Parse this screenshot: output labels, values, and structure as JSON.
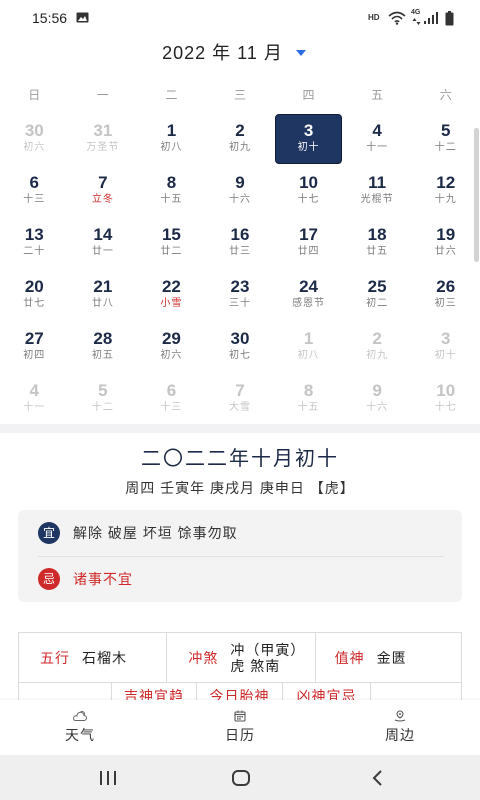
{
  "theme": {
    "navy": "#1f3562",
    "red": "#cf2a2a",
    "dropdown_blue": "#2d6be0",
    "muted": "#c4c4c4"
  },
  "status_bar": {
    "time": "15:56",
    "hd": "HD",
    "network": "4G",
    "left_icons": [
      "image-icon"
    ],
    "right_icons": [
      "wifi-icon",
      "signal-icon",
      "battery-icon"
    ]
  },
  "header": {
    "month_label": "2022 年 11 月",
    "dropdown_icon": "triangle-down-icon"
  },
  "weekdays": [
    "日",
    "一",
    "二",
    "三",
    "四",
    "五",
    "六"
  ],
  "calendar": {
    "weeks": [
      [
        {
          "day": "30",
          "sub": "初六",
          "muted": true
        },
        {
          "day": "31",
          "sub": "万圣节",
          "muted": true
        },
        {
          "day": "1",
          "sub": "初八"
        },
        {
          "day": "2",
          "sub": "初九"
        },
        {
          "day": "3",
          "sub": "初十",
          "selected": true
        },
        {
          "day": "4",
          "sub": "十一"
        },
        {
          "day": "5",
          "sub": "十二"
        }
      ],
      [
        {
          "day": "6",
          "sub": "十三"
        },
        {
          "day": "7",
          "sub": "立冬",
          "solar_term": true
        },
        {
          "day": "8",
          "sub": "十五"
        },
        {
          "day": "9",
          "sub": "十六"
        },
        {
          "day": "10",
          "sub": "十七"
        },
        {
          "day": "11",
          "sub": "光棍节"
        },
        {
          "day": "12",
          "sub": "十九"
        }
      ],
      [
        {
          "day": "13",
          "sub": "二十"
        },
        {
          "day": "14",
          "sub": "廿一"
        },
        {
          "day": "15",
          "sub": "廿二"
        },
        {
          "day": "16",
          "sub": "廿三"
        },
        {
          "day": "17",
          "sub": "廿四"
        },
        {
          "day": "18",
          "sub": "廿五"
        },
        {
          "day": "19",
          "sub": "廿六"
        }
      ],
      [
        {
          "day": "20",
          "sub": "廿七"
        },
        {
          "day": "21",
          "sub": "廿八"
        },
        {
          "day": "22",
          "sub": "小雪",
          "solar_term": true
        },
        {
          "day": "23",
          "sub": "三十"
        },
        {
          "day": "24",
          "sub": "感恩节"
        },
        {
          "day": "25",
          "sub": "初二"
        },
        {
          "day": "26",
          "sub": "初三"
        }
      ],
      [
        {
          "day": "27",
          "sub": "初四"
        },
        {
          "day": "28",
          "sub": "初五"
        },
        {
          "day": "29",
          "sub": "初六"
        },
        {
          "day": "30",
          "sub": "初七"
        },
        {
          "day": "1",
          "sub": "初八",
          "muted": true
        },
        {
          "day": "2",
          "sub": "初九",
          "muted": true
        },
        {
          "day": "3",
          "sub": "初十",
          "muted": true
        }
      ],
      [
        {
          "day": "4",
          "sub": "十一",
          "muted": true
        },
        {
          "day": "5",
          "sub": "十二",
          "muted": true
        },
        {
          "day": "6",
          "sub": "十三",
          "muted": true
        },
        {
          "day": "7",
          "sub": "大雪",
          "muted": true
        },
        {
          "day": "8",
          "sub": "十五",
          "muted": true
        },
        {
          "day": "9",
          "sub": "十六",
          "muted": true
        },
        {
          "day": "10",
          "sub": "十七",
          "muted": true
        }
      ]
    ]
  },
  "almanac": {
    "lunar_date": "二〇二二年十月初十",
    "ganzhi": "周四 壬寅年 庚戌月 庚申日 【虎】",
    "yi": {
      "badge": "宜",
      "text": "解除 破屋 坏垣 馀事勿取"
    },
    "ji": {
      "badge": "忌",
      "text": "诸事不宜"
    },
    "table": {
      "row1": [
        {
          "label": "五行",
          "value": "石榴木"
        },
        {
          "label": "冲煞",
          "value": "冲（甲寅）虎 煞南"
        },
        {
          "label": "值神",
          "value": "金匮"
        }
      ],
      "row2": [
        "吉神宜趋",
        "今日胎神",
        "凶神宜忌"
      ]
    }
  },
  "bottom_nav": {
    "items": [
      {
        "label": "天气",
        "icon": "weather-icon"
      },
      {
        "label": "日历",
        "icon": "calendar-icon"
      },
      {
        "label": "周边",
        "icon": "nearby-icon"
      }
    ]
  },
  "system_nav": {
    "icons": [
      "recents-icon",
      "home-icon",
      "back-icon"
    ]
  }
}
